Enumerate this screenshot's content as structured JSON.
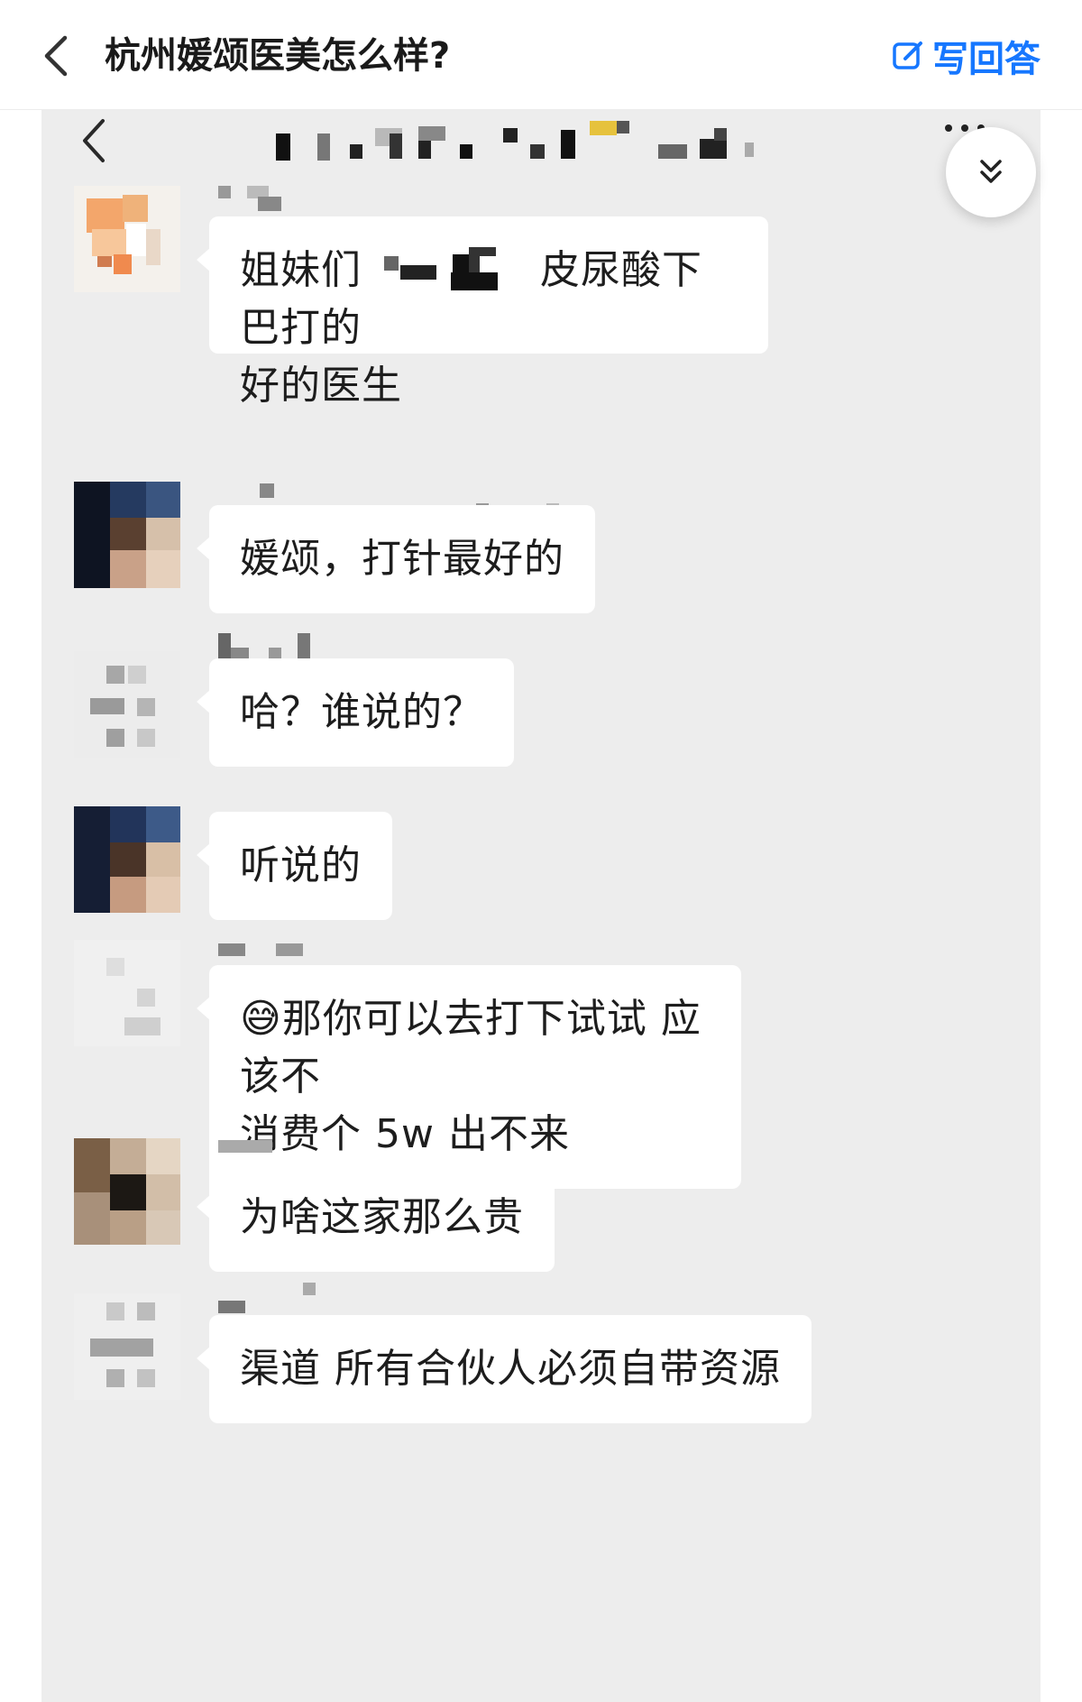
{
  "appbar": {
    "title": "杭州媛颂医美怎么样?",
    "write_answer_label": "写回答",
    "accent_color": "#1677ff",
    "back_icon": "chevron-left-icon",
    "write_icon": "edit-icon"
  },
  "fab": {
    "icon": "double-chevron-down-icon"
  },
  "chat": {
    "background": "#ededed",
    "messages": [
      {
        "segments": [
          "姐妹们",
          "皮尿酸下巴打的",
          "好的医生"
        ]
      },
      {
        "text": "媛颂，打针最好的"
      },
      {
        "text": "哈？谁说的？"
      },
      {
        "text": "听说的"
      },
      {
        "emoji": "😅",
        "text_line1": "那你可以去打下试试 应该不",
        "text_line2": "消费个 5w 出不来"
      },
      {
        "text": "为啥这家那么贵"
      },
      {
        "text": "渠道 所有合伙人必须自带资源"
      }
    ]
  }
}
